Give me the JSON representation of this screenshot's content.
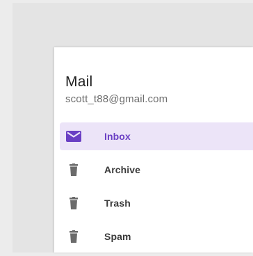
{
  "drawer": {
    "title": "Mail",
    "account": "scott_t88@gmail.com"
  },
  "nav": {
    "items": [
      {
        "label": "Inbox",
        "icon": "mail-icon",
        "selected": true
      },
      {
        "label": "Archive",
        "icon": "trash-icon",
        "selected": false
      },
      {
        "label": "Trash",
        "icon": "trash-icon",
        "selected": false
      },
      {
        "label": "Spam",
        "icon": "trash-icon",
        "selected": false
      }
    ]
  },
  "colors": {
    "accent": "#6a3fc4",
    "selected_bg": "#ece4f8",
    "icon_gray": "#6b6b6b"
  }
}
